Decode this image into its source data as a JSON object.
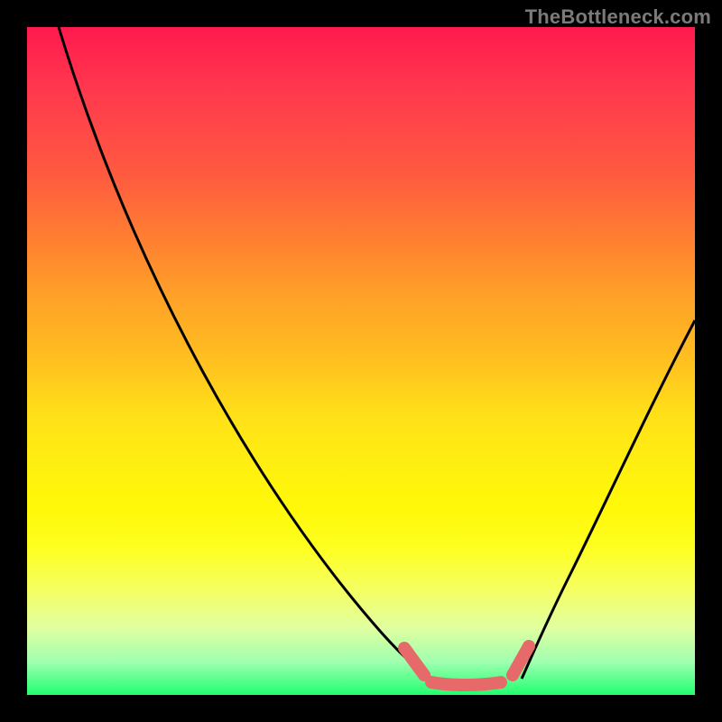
{
  "watermark": {
    "text": "TheBottleneck.com"
  },
  "chart_data": {
    "type": "line",
    "title": "",
    "xlabel": "",
    "ylabel": "",
    "xlim": [
      0,
      100
    ],
    "ylim": [
      0,
      100
    ],
    "grid": false,
    "legend": false,
    "background_gradient": {
      "top_color": "#ff1a4d",
      "bottom_color": "#20ff70",
      "description": "vertical rainbow gradient red→orange→yellow→green"
    },
    "series": [
      {
        "name": "left-curve",
        "color": "#000000",
        "x": [
          5,
          12,
          20,
          28,
          35,
          42,
          48,
          54,
          58,
          61
        ],
        "values": [
          100,
          80,
          62,
          46,
          32,
          21,
          13,
          7,
          4,
          2
        ]
      },
      {
        "name": "right-curve",
        "color": "#000000",
        "x": [
          74,
          78,
          82,
          86,
          90,
          95,
          100
        ],
        "values": [
          2,
          7,
          14,
          23,
          33,
          44,
          56
        ]
      },
      {
        "name": "pink-highlight",
        "color": "#e66a6a",
        "x": [
          57,
          60,
          64,
          68,
          71,
          73,
          76
        ],
        "values": [
          7,
          3,
          1,
          1,
          1,
          3,
          7
        ]
      }
    ],
    "annotations": [
      {
        "text": "TheBottleneck.com",
        "position": "top-right",
        "color": "#7a7a7a"
      }
    ]
  }
}
